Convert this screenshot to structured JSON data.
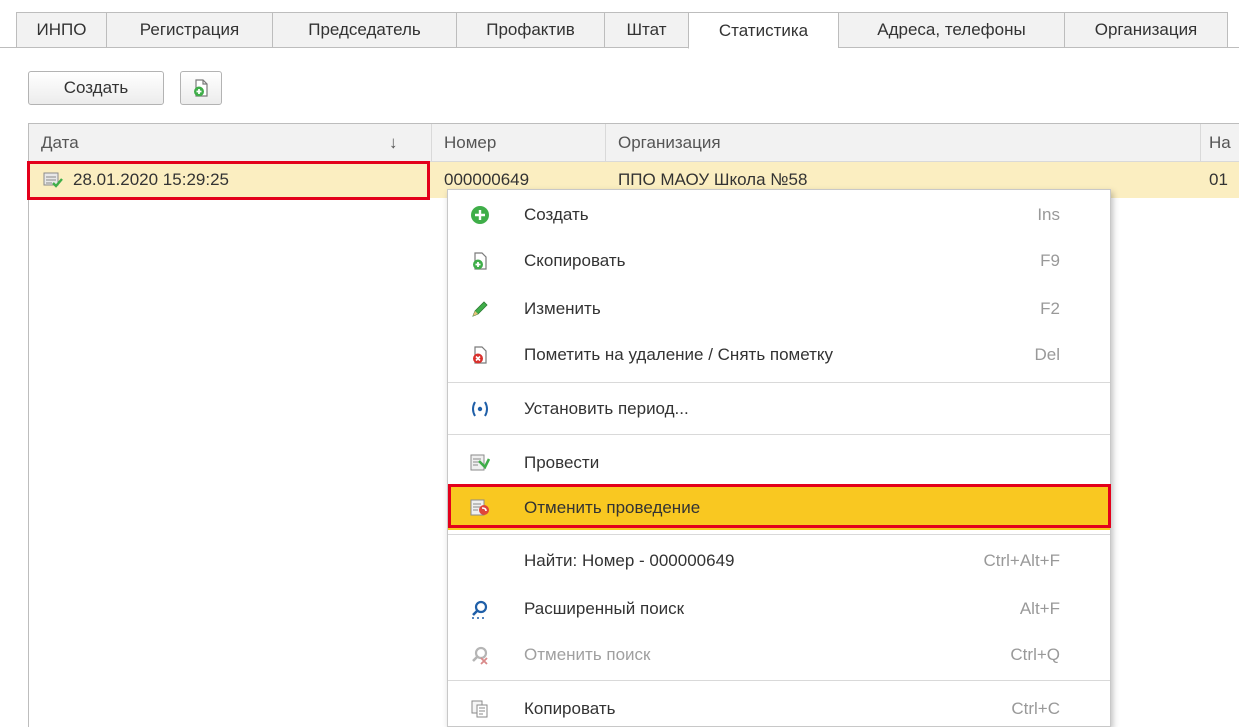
{
  "tabs": [
    {
      "label": "ИНПО"
    },
    {
      "label": "Регистрация"
    },
    {
      "label": "Председатель"
    },
    {
      "label": "Профактив"
    },
    {
      "label": "Штат"
    },
    {
      "label": "Статистика",
      "active": true
    },
    {
      "label": "Адреса, телефоны"
    },
    {
      "label": "Организация"
    }
  ],
  "toolbar": {
    "create_label": "Создать",
    "copy_icon": "copy-document-icon"
  },
  "table": {
    "columns": [
      "Дата",
      "Номер",
      "Организация",
      "На"
    ],
    "sort_indicator": "↓",
    "rows": [
      {
        "date": "28.01.2020 15:29:25",
        "number": "000000649",
        "organization": "ППО МАОУ Школа №58",
        "extra": "01"
      }
    ]
  },
  "context_menu": {
    "items": [
      {
        "label": "Создать",
        "shortcut": "Ins",
        "icon": "plus-circle-icon"
      },
      {
        "label": "Скопировать",
        "shortcut": "F9",
        "icon": "copy-document-icon"
      },
      {
        "label": "Изменить",
        "shortcut": "F2",
        "icon": "pencil-icon"
      },
      {
        "label": "Пометить на удаление / Снять пометку",
        "shortcut": "Del",
        "icon": "delete-mark-icon"
      },
      {
        "label": "Установить период...",
        "shortcut": "",
        "icon": "period-icon"
      },
      {
        "label": "Провести",
        "shortcut": "",
        "icon": "post-document-icon"
      },
      {
        "label": "Отменить проведение",
        "shortcut": "",
        "icon": "unpost-document-icon"
      },
      {
        "label": "Найти: Номер - 000000649",
        "shortcut": "Ctrl+Alt+F",
        "icon": ""
      },
      {
        "label": "Расширенный поиск",
        "shortcut": "Alt+F",
        "icon": "advanced-search-icon"
      },
      {
        "label": "Отменить поиск",
        "shortcut": "Ctrl+Q",
        "icon": "cancel-search-icon"
      },
      {
        "label": "Копировать",
        "shortcut": "Ctrl+C",
        "icon": "clipboard-copy-icon"
      }
    ]
  },
  "colors": {
    "highlight": "#f9c821",
    "selected_row": "#fbeec1",
    "annotation_red": "#e3001b",
    "green_icon": "#3fae49"
  }
}
